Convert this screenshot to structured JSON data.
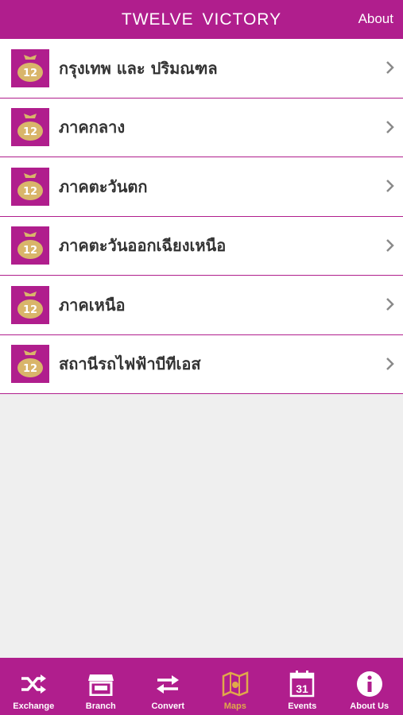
{
  "header": {
    "title": "TWELVE  VICTORY",
    "about_label": "About"
  },
  "regions": [
    {
      "label": "กรุงเทพ และ ปริมณฑล"
    },
    {
      "label": "ภาคกลาง"
    },
    {
      "label": "ภาคตะวันตก"
    },
    {
      "label": "ภาคตะวันออกเฉียงเหนือ"
    },
    {
      "label": "ภาคเหนือ"
    },
    {
      "label": "สถานีรถไฟฟ้าบีทีเอส"
    }
  ],
  "row_icon": {
    "name": "money-bag-icon",
    "text": "12"
  },
  "tabs": [
    {
      "label": "Exchange",
      "icon": "shuffle-icon"
    },
    {
      "label": "Branch",
      "icon": "store-icon"
    },
    {
      "label": "Convert",
      "icon": "swap-arrows-icon"
    },
    {
      "label": "Maps",
      "icon": "map-icon",
      "active": true
    },
    {
      "label": "Events",
      "icon": "calendar-icon",
      "calendar_day": "31"
    },
    {
      "label": "About Us",
      "icon": "info-icon"
    }
  ],
  "colors": {
    "brand": "#b01e8d",
    "active_tab": "#e0a94a",
    "background": "#efefef"
  }
}
